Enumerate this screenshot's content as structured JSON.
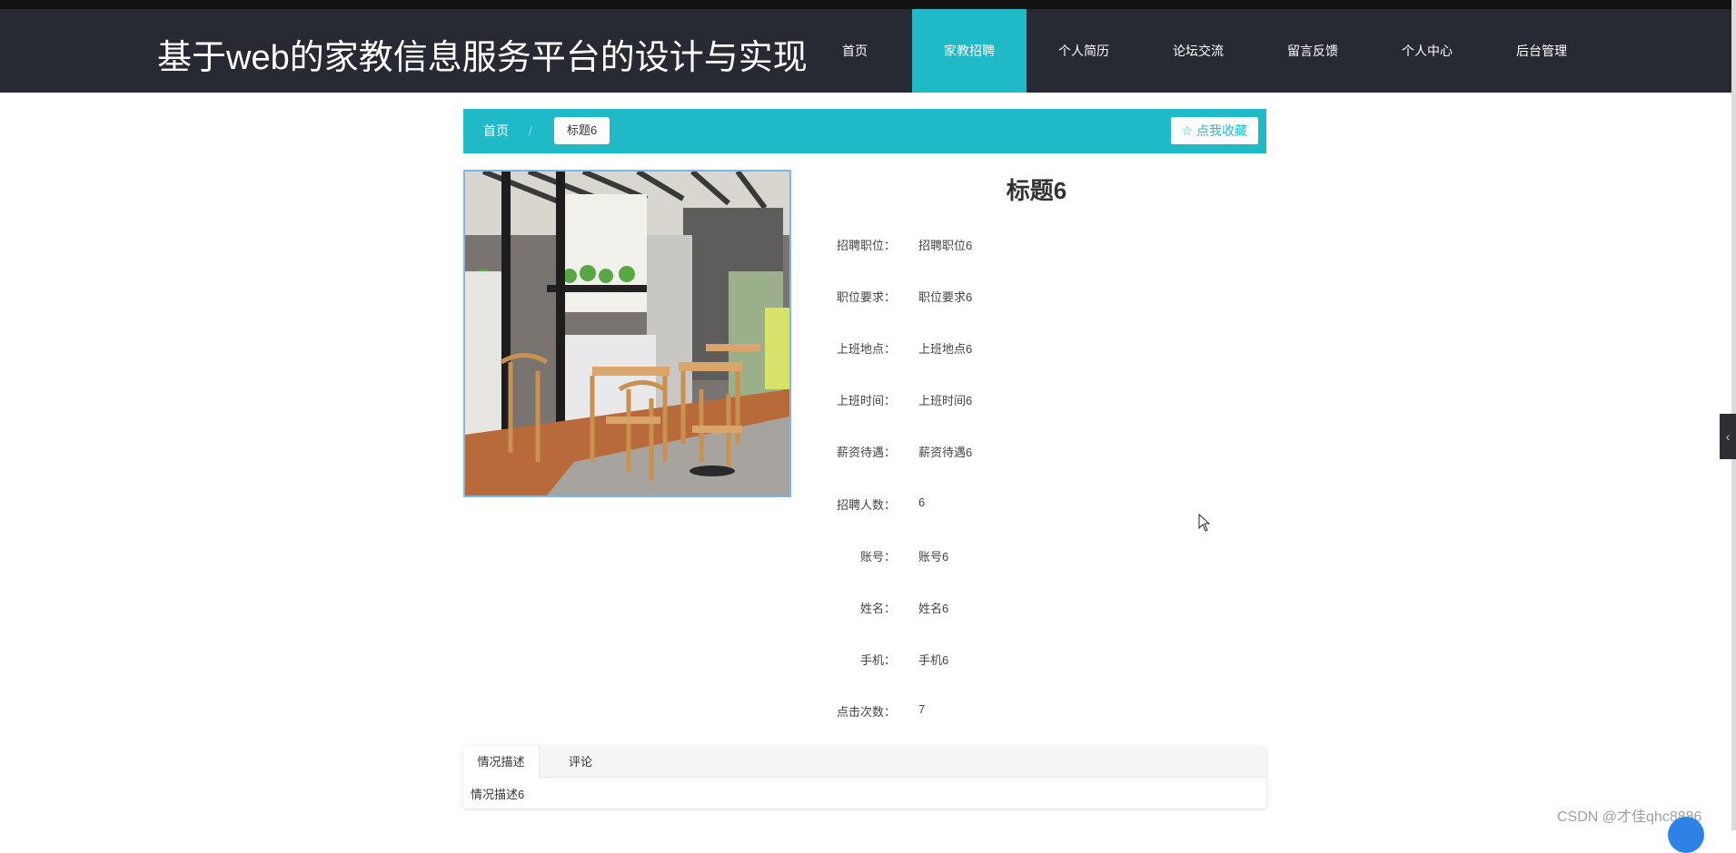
{
  "header": {
    "site_title": "基于web的家教信息服务平台的设计与实现",
    "nav": [
      "首页",
      "家教招聘",
      "个人简历",
      "论坛交流",
      "留言反馈",
      "个人中心",
      "后台管理"
    ],
    "active_nav": "家教招聘"
  },
  "breadcrumb": {
    "home": "首页",
    "separator": "/",
    "current": "标题6"
  },
  "favorite_button": {
    "icon": "star-outline-icon",
    "label": "☆ 点我收藏"
  },
  "detail": {
    "title": "标题6",
    "fields": [
      {
        "label": "招聘职位：",
        "value": "招聘职位6"
      },
      {
        "label": "职位要求：",
        "value": "职位要求6"
      },
      {
        "label": "上班地点：",
        "value": "上班地点6"
      },
      {
        "label": "上班时间：",
        "value": "上班时间6"
      },
      {
        "label": "薪资待遇：",
        "value": "薪资待遇6"
      },
      {
        "label": "招聘人数：",
        "value": "6"
      },
      {
        "label": "账号：",
        "value": "账号6"
      },
      {
        "label": "姓名：",
        "value": "姓名6"
      },
      {
        "label": "手机：",
        "value": "手机6"
      },
      {
        "label": "点击次数：",
        "value": "7"
      }
    ]
  },
  "tabs": {
    "items": [
      "情况描述",
      "评论"
    ],
    "active": "情况描述",
    "content": "情况描述6"
  },
  "side_tab": {
    "icon": "chevron-left-icon",
    "glyph": "‹"
  },
  "watermark": "CSDN @才佳qhc8886",
  "colors": {
    "accent": "#1fb9c8",
    "header_bg": "#272a33"
  }
}
